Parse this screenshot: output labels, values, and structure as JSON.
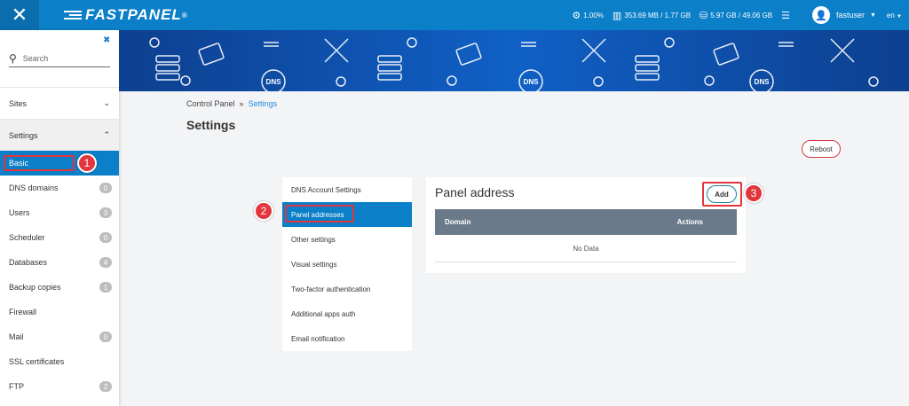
{
  "app": {
    "brand": "FASTPANEL",
    "brand_mark": "®"
  },
  "topbar": {
    "cpu": "1.00%",
    "ram": "353.69 MB / 1.77 GB",
    "disk": "5.97 GB / 49.06 GB",
    "username": "fastuser",
    "language": "en"
  },
  "sidebar": {
    "search_placeholder": "Search",
    "groups": [
      {
        "label": "Sites"
      },
      {
        "label": "Settings"
      }
    ],
    "items": [
      {
        "label": "Basic",
        "badge": ""
      },
      {
        "label": "DNS domains",
        "badge": "0"
      },
      {
        "label": "Users",
        "badge": "3"
      },
      {
        "label": "Scheduler",
        "badge": "0"
      },
      {
        "label": "Databases",
        "badge": "4"
      },
      {
        "label": "Backup copies",
        "badge": "1"
      },
      {
        "label": "Firewall",
        "badge": ""
      },
      {
        "label": "Mail",
        "badge": "0"
      },
      {
        "label": "SSL certificates",
        "badge": ""
      },
      {
        "label": "FTP",
        "badge": "2"
      }
    ]
  },
  "banner": {
    "label": "DNS"
  },
  "breadcrumb": {
    "root": "Control Panel",
    "separator": "»",
    "current": "Settings"
  },
  "page": {
    "title": "Settings",
    "reboot_label": "Reboot"
  },
  "submenu": [
    {
      "label": "DNS Account Settings"
    },
    {
      "label": "Panel addresses"
    },
    {
      "label": "Other settings"
    },
    {
      "label": "Visual settings"
    },
    {
      "label": "Two-factor authentication"
    },
    {
      "label": "Additional apps auth"
    },
    {
      "label": "Email notification"
    }
  ],
  "panel": {
    "title": "Panel address",
    "add_label": "Add",
    "columns": [
      "Domain",
      "Actions"
    ],
    "empty_text": "No Data"
  },
  "annotations": [
    "1",
    "2",
    "3"
  ],
  "colors": {
    "primary": "#0b7fc7",
    "annotation": "#e2353c",
    "banner": "#1060c6"
  }
}
